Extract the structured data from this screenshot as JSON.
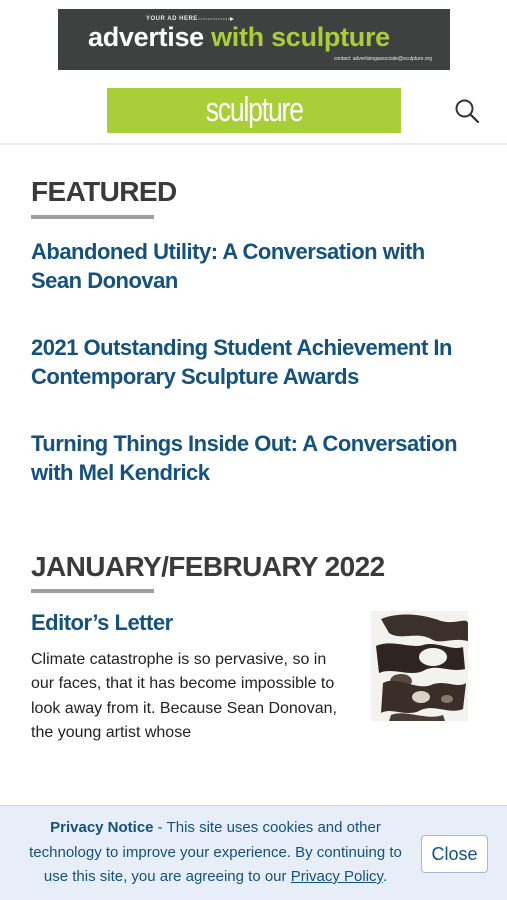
{
  "ad": {
    "eyebrow": "YOUR AD HERE",
    "headline_white": "advertise",
    "headline_green": "with sculpture",
    "contact": "contact: advertisingassociate@sculpture.org"
  },
  "header": {
    "logo_text": "sculpture",
    "search_icon": "search-icon"
  },
  "featured": {
    "heading": "FEATURED",
    "items": [
      {
        "title_line1": "Abandoned Utility: A Conversation with",
        "title_line2": "Sean Donovan"
      },
      {
        "title_line1": "2021 Outstanding Student Achievement In",
        "title_line2": "Contemporary Sculpture Awards"
      },
      {
        "title_line1": "Turning Things Inside Out: A Conversation",
        "title_line2": "with Mel Kendrick"
      }
    ]
  },
  "issue": {
    "heading": "JANUARY/FEBRUARY 2022",
    "article": {
      "title": "Editor’s Letter",
      "excerpt": "Climate catastrophe is so pervasive, so in our faces, that it has become impossible to look away from it. Because Sean Donovan, the young artist whose"
    }
  },
  "privacy": {
    "label": "Privacy Notice",
    "text": " - This site uses cookies and other technology to improve your experience. By continuing to use this site, you are agreeing to our ",
    "link": "Privacy Policy",
    "end": ".",
    "close": "Close"
  },
  "colors": {
    "brand_green": "#a9cf38",
    "link_blue": "#13517e",
    "ad_background": "#3f4140",
    "privacy_background": "#e7eef7"
  }
}
